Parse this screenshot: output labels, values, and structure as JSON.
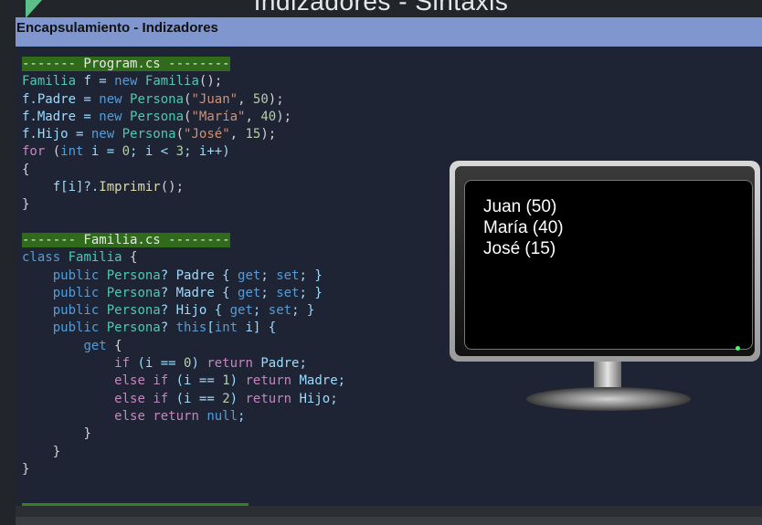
{
  "slide": {
    "title": "Indizadores - Sintaxis"
  },
  "header": {
    "label": "Encapsulamiento - Indizadores"
  },
  "program": {
    "file_label": "------- Program.cs --------",
    "var_stmt": {
      "type": "Familia",
      "rest_a": " f = ",
      "kw_new": "new",
      "rest_b": " ",
      "ctor": "Familia",
      "end": "();"
    },
    "padre": {
      "lhs": "f.Padre = ",
      "kw_new": "new",
      "type": "Persona",
      "open": "(",
      "str": "\"Juan\"",
      "comma": ", ",
      "num": "50",
      "end": ");"
    },
    "madre": {
      "lhs": "f.Madre = ",
      "kw_new": "new",
      "type": "Persona",
      "open": "(",
      "str": "\"María\"",
      "comma": ", ",
      "num": "40",
      "end": ");"
    },
    "hijo": {
      "lhs": "f.Hijo = ",
      "kw_new": "new",
      "type": "Persona",
      "open": "(",
      "str": "\"José\"",
      "comma": ", ",
      "num": "15",
      "end": ");"
    },
    "for_stmt": {
      "kw_for": "for",
      "open": " (",
      "kw_int": "int",
      "a": " i = ",
      "zero": "0",
      "b": "; i < ",
      "three": "3",
      "c": "; i++)"
    },
    "brace_open": "{",
    "body": "    f[i]?.",
    "method": "Imprimir",
    "body_end": "();",
    "brace_close": "}"
  },
  "familia": {
    "file_label": "------- Familia.cs --------",
    "class_line": {
      "kw": "class",
      "name": "Familia",
      "brace": " {"
    },
    "padre": {
      "kw": "public",
      "type": "Persona",
      "rest": "? Padre { ",
      "get": "get",
      "semi": "; ",
      "set": "set",
      "end": "; }"
    },
    "madre": {
      "kw": "public",
      "type": "Persona",
      "rest": "? Madre { ",
      "get": "get",
      "semi": "; ",
      "set": "set",
      "end": "; }"
    },
    "hijo": {
      "kw": "public",
      "type": "Persona",
      "rest": "? Hijo { ",
      "get": "get",
      "semi": "; ",
      "set": "set",
      "end": "; }"
    },
    "indexer": {
      "kw": "public",
      "type": "Persona",
      "q": "? ",
      "kw_this": "this",
      "open": "[",
      "kw_int": "int",
      "rest": " i] {"
    },
    "get_line": {
      "kw": "get",
      "brace": " {"
    },
    "if0": {
      "kw_if": "if",
      "a": " (i == ",
      "n": "0",
      "b": ") ",
      "kw_ret": "return",
      "c": " Padre;"
    },
    "if1": {
      "kw_else": "else",
      "sp": " ",
      "kw_if": "if",
      "a": " (i == ",
      "n": "1",
      "b": ") ",
      "kw_ret": "return",
      "c": " Madre;"
    },
    "if2": {
      "kw_else": "else",
      "sp": " ",
      "kw_if": "if",
      "a": " (i == ",
      "n": "2",
      "b": ") ",
      "kw_ret": "return",
      "c": " Hijo;"
    },
    "else_ret": {
      "kw_else": "else",
      "sp": " ",
      "kw_ret": "return",
      "sp2": " ",
      "null": "null",
      "end": ";"
    },
    "close3": "}",
    "close2": "}",
    "close1": "}"
  },
  "console": {
    "lines": [
      "Juan (50)",
      "María (40)",
      "José (15)"
    ]
  },
  "colors": {
    "header_bar": "#7f96cf",
    "code_bg": "#1e2433",
    "filename_bg": "#2f6b1a",
    "keyword": "#c586c0",
    "type": "#4ec9b0",
    "string": "#ce9178",
    "number": "#b5cea8"
  }
}
